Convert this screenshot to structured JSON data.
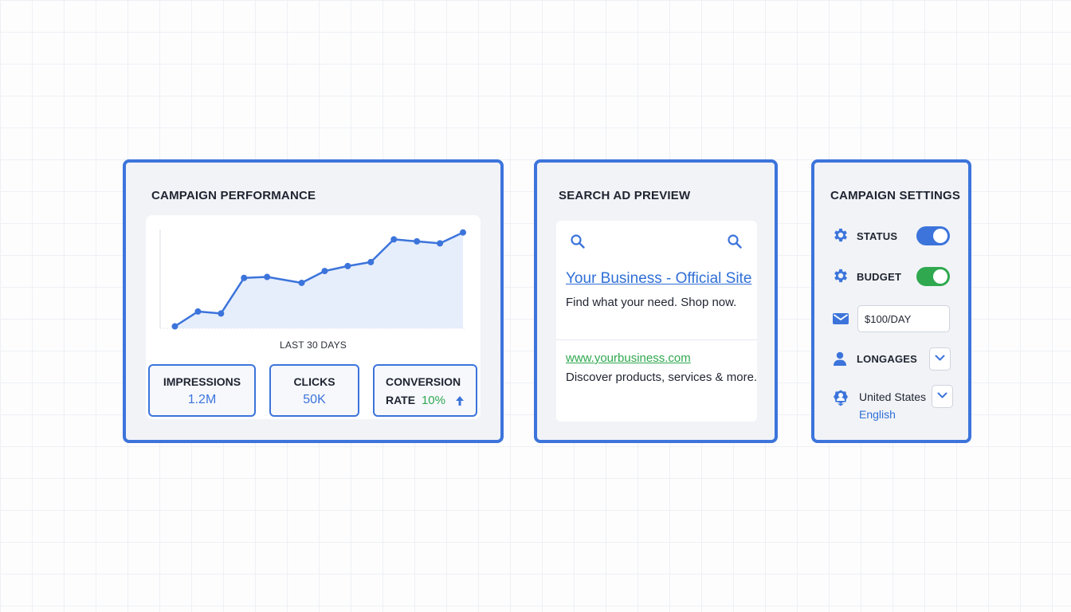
{
  "colors": {
    "accent": "#3c74db",
    "success": "#2fa84f",
    "link": "#2f6fd6",
    "toggle_on_status": "#3c74db",
    "toggle_on_budget": "#2fa84f"
  },
  "performance": {
    "title": "CAMPAIGN PERFORMANCE",
    "chart_xlabel": "LAST 30 DAYS",
    "metrics": {
      "impressions_label": "IMPRESSIONS",
      "impressions_value": "1.2M",
      "clicks_label": "CLICKS",
      "clicks_value": "50K",
      "conversion_label": "CONVERSION",
      "conversion_rate_word": "RATE",
      "conversion_value": "10%",
      "conversion_trend_icon": "arrow-up-icon"
    }
  },
  "chart_data": {
    "type": "area",
    "x": [
      1,
      3,
      5,
      7,
      9,
      12,
      14,
      16,
      18,
      20,
      22,
      24,
      26
    ],
    "values": [
      2,
      17,
      15,
      51,
      52,
      46,
      58,
      63,
      67,
      90,
      88,
      86,
      97
    ],
    "title": "",
    "xlabel": "LAST 30 DAYS",
    "ylabel": "",
    "xlim": [
      0,
      26
    ],
    "ylim": [
      0,
      100
    ],
    "grid": false,
    "legend": "none",
    "line_color": "#3c74db",
    "fill_color": "#e6eefb"
  },
  "ad_preview": {
    "title": "SEARCH AD PREVIEW",
    "icons": [
      "search-icon",
      "search-icon"
    ],
    "headline": "Your Business - Official Site",
    "description": "Find what your need. Shop now.",
    "display_url": "www.yourbusiness.com",
    "description2": "Discover products, services & more."
  },
  "settings": {
    "title": "CAMPAIGN SETTINGS",
    "status_label": "STATUS",
    "status_on": true,
    "budget_label": "BUDGET",
    "budget_on": true,
    "budget_value": "$100/DAY",
    "languages_label": "LONGAGES",
    "location": "United States",
    "language": "English",
    "icons": [
      "gear-icon",
      "gear-icon",
      "envelope-icon",
      "person-icon",
      "location-person-icon",
      "chevron-down-icon"
    ]
  }
}
